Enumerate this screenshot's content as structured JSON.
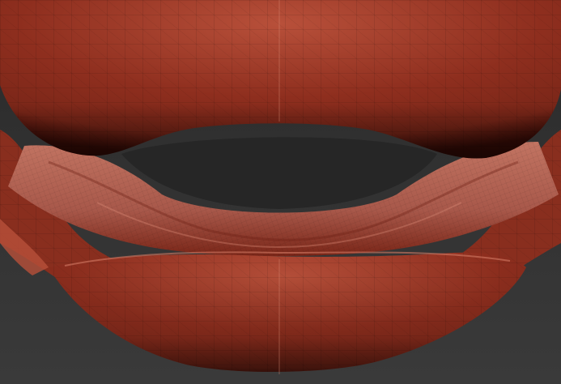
{
  "viewport": {
    "background_top": "#2a2a2a",
    "background_bottom": "#3a3a3a"
  },
  "material": {
    "base": "#8e2e1e",
    "light": "#b8503a",
    "mid": "#7a2618",
    "dark": "#3a0c06",
    "inner": "#a8584a",
    "inner_light": "#c27462",
    "wire": "#5a1a10"
  }
}
